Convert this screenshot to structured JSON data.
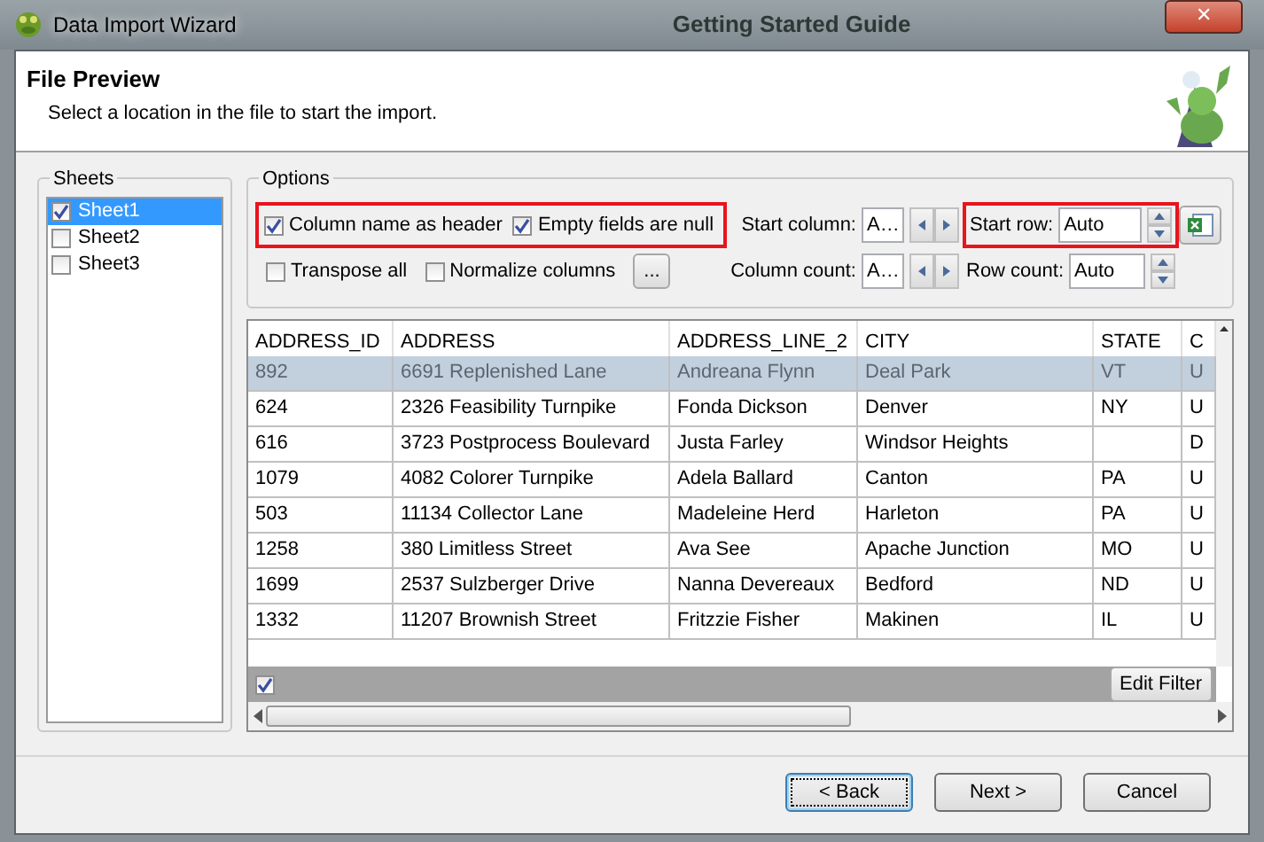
{
  "window": {
    "title": "Data Import Wizard",
    "close": "✕"
  },
  "background_window": {
    "title": "Getting Started Guide"
  },
  "header": {
    "title": "File Preview",
    "subtitle": "Select a location in the file to start the import."
  },
  "sheets": {
    "label": "Sheets",
    "items": [
      {
        "label": "Sheet1",
        "checked": true,
        "selected": true
      },
      {
        "label": "Sheet2",
        "checked": false,
        "selected": false
      },
      {
        "label": "Sheet3",
        "checked": false,
        "selected": false
      }
    ]
  },
  "options": {
    "label": "Options",
    "highlight_group": {
      "highlighted": true,
      "items": [
        {
          "label": "Column name as header",
          "checked": true
        },
        {
          "label": "Empty fields are null",
          "checked": true
        }
      ]
    },
    "checkboxes": [
      {
        "label": "Transpose all",
        "checked": false
      },
      {
        "label": "Normalize columns",
        "checked": false
      }
    ],
    "more_button": "...",
    "fields": [
      {
        "label": "Start column:",
        "value": "A…",
        "kind": "horizontal",
        "highlighted": false
      },
      {
        "label": "Column count:",
        "value": "A…",
        "kind": "horizontal",
        "highlighted": false
      },
      {
        "label": "Start row:",
        "value": "Auto",
        "kind": "vertical",
        "highlighted": true
      },
      {
        "label": "Row count:",
        "value": "Auto",
        "kind": "vertical",
        "highlighted": false
      }
    ]
  },
  "table": {
    "columns": [
      "ADDRESS_ID",
      "ADDRESS",
      "ADDRESS_LINE_2",
      "CITY",
      "STATE",
      "C"
    ],
    "rows": [
      {
        "selected": true,
        "cells": [
          "892",
          "6691 Replenished Lane",
          "Andreana Flynn",
          "Deal Park",
          "VT",
          "U"
        ]
      },
      {
        "selected": false,
        "cells": [
          "624",
          "2326 Feasibility Turnpike",
          "Fonda Dickson",
          "Denver",
          "NY",
          "U"
        ]
      },
      {
        "selected": false,
        "cells": [
          "616",
          "3723 Postprocess Boulevard",
          "Justa Farley",
          "Windsor Heights",
          "",
          "D"
        ]
      },
      {
        "selected": false,
        "cells": [
          "1079",
          "4082 Colorer Turnpike",
          "Adela Ballard",
          "Canton",
          "PA",
          "U"
        ]
      },
      {
        "selected": false,
        "cells": [
          "503",
          "11134 Collector Lane",
          "Madeleine Herd",
          "Harleton",
          "PA",
          "U"
        ]
      },
      {
        "selected": false,
        "cells": [
          "1258",
          "380 Limitless Street",
          "Ava See",
          "Apache Junction",
          "MO",
          "U"
        ]
      },
      {
        "selected": false,
        "cells": [
          "1699",
          "2537 Sulzberger Drive",
          "Nanna Devereaux",
          "Bedford",
          "ND",
          "U"
        ]
      },
      {
        "selected": false,
        "cells": [
          "1332",
          "11207 Brownish Street",
          "Fritzzie Fisher",
          "Makinen",
          "IL",
          "U"
        ]
      }
    ],
    "filter_checked": true,
    "filter_button": "Edit Filter"
  },
  "buttons": [
    {
      "label": "< Back",
      "focused": true
    },
    {
      "label": "Next >",
      "focused": false
    },
    {
      "label": "Cancel",
      "focused": false
    }
  ]
}
